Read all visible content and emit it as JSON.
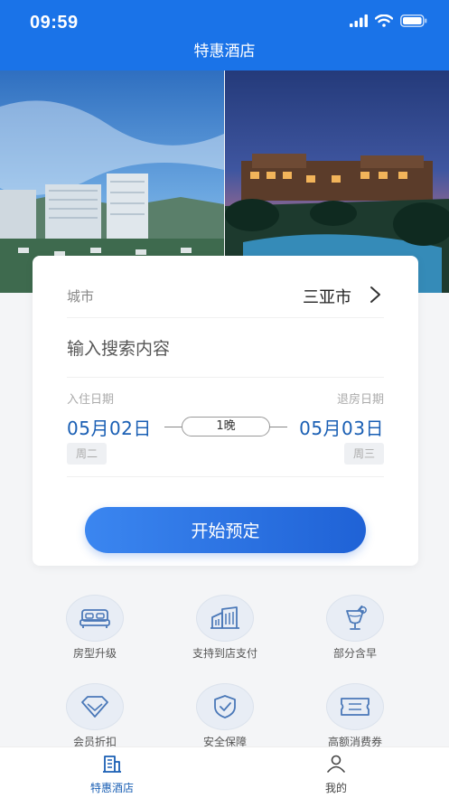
{
  "status_bar": {
    "time": "09:59"
  },
  "header": {
    "title": "特惠酒店"
  },
  "booking": {
    "city_label": "城市",
    "city_value": "三亚市",
    "search_placeholder": "输入搜索内容",
    "checkin_label": "入住日期",
    "checkout_label": "退房日期",
    "checkin_date": "05月02日",
    "checkout_date": "05月03日",
    "checkin_weekday": "周二",
    "checkout_weekday": "周三",
    "nights": "1晚",
    "book_button": "开始预定"
  },
  "features": [
    {
      "label": "房型升级",
      "icon": "bed-icon"
    },
    {
      "label": "支持到店支付",
      "icon": "building-icon"
    },
    {
      "label": "部分含早",
      "icon": "drink-icon"
    },
    {
      "label": "会员折扣",
      "icon": "diamond-icon"
    },
    {
      "label": "安全保障",
      "icon": "shield-check-icon"
    },
    {
      "label": "高额消费券",
      "icon": "ticket-icon"
    }
  ],
  "tabbar": {
    "tabs": [
      {
        "label": "特惠酒店",
        "icon": "hotel-icon",
        "active": true
      },
      {
        "label": "我的",
        "icon": "person-icon",
        "active": false
      }
    ]
  },
  "colors": {
    "primary": "#1a73e8",
    "date_text": "#1a5fb4",
    "tab_active": "#1a5fb4"
  }
}
